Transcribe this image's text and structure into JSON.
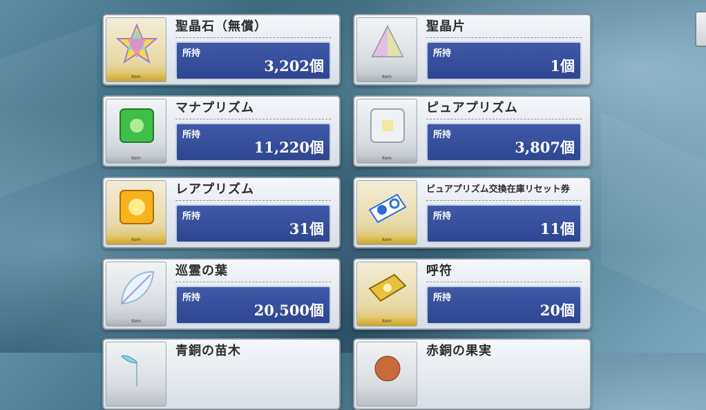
{
  "items": [
    {
      "name": "聖晶石（無償）",
      "owned_label": "所持",
      "count": "3,202個",
      "badge": "Item",
      "icon": "saint-quartz-icon",
      "frame": "gold"
    },
    {
      "name": "聖晶片",
      "owned_label": "所持",
      "count": "1個",
      "badge": "Item",
      "icon": "quartz-fragment-icon",
      "frame": "silver"
    },
    {
      "name": "マナプリズム",
      "owned_label": "所持",
      "count": "11,220個",
      "badge": "Item",
      "icon": "mana-prism-icon",
      "frame": "silver"
    },
    {
      "name": "ピュアプリズム",
      "owned_label": "所持",
      "count": "3,807個",
      "badge": "Item",
      "icon": "pure-prism-icon",
      "frame": "silver"
    },
    {
      "name": "レアプリズム",
      "owned_label": "所持",
      "count": "31個",
      "badge": "Item",
      "icon": "rare-prism-icon",
      "frame": "gold"
    },
    {
      "name": "ピュアプリズム交換在庫リセット券",
      "owned_label": "所持",
      "count": "11個",
      "badge": "Item",
      "icon": "reset-ticket-icon",
      "frame": "gold"
    },
    {
      "name": "巡霊の葉",
      "owned_label": "所持",
      "count": "20,500個",
      "badge": "Item",
      "icon": "spirit-leaf-icon",
      "frame": "silver"
    },
    {
      "name": "呼符",
      "owned_label": "所持",
      "count": "20個",
      "badge": "Item",
      "icon": "summon-ticket-icon",
      "frame": "gold"
    },
    {
      "name": "青銅の苗木",
      "icon": "bronze-sapling-icon",
      "frame": "silver"
    },
    {
      "name": "赤銅の果実",
      "icon": "copper-fruit-icon",
      "frame": "silver"
    }
  ],
  "colors": {
    "panel": "#2d4690",
    "gold_frame": "#d8b85c",
    "silver_frame": "#b9bfc6"
  }
}
